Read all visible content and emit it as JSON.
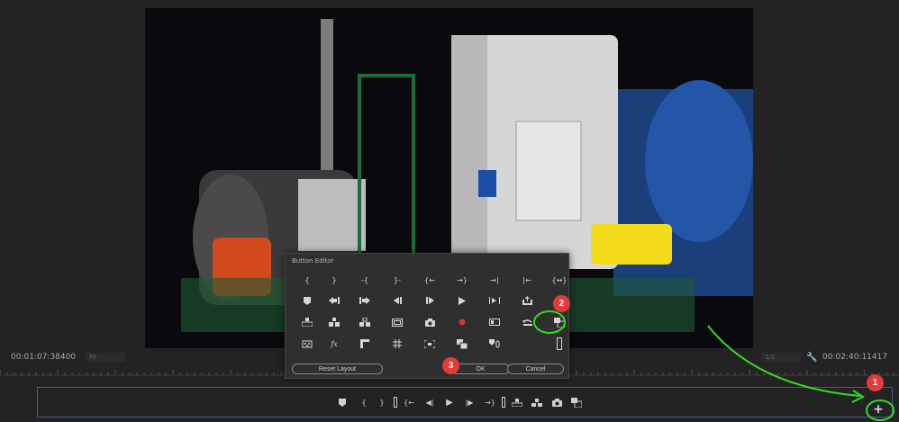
{
  "player": {
    "timecode_in": "00:01:07:38400",
    "timecode_out": "00:02:40:11417",
    "fit_label": "Fit",
    "resolution_label": "1/2"
  },
  "button_editor": {
    "title": "Button Editor",
    "reset_label": "Reset Layout",
    "ok_label": "OK",
    "cancel_label": "Cancel",
    "grid": [
      [
        "{",
        "}",
        "-{",
        "}-",
        "{←",
        "→}",
        "→|",
        "|←",
        "{↔}"
      ],
      [
        "marker-icon",
        "go-to-in-icon",
        "go-to-out-icon",
        "step-back-icon",
        "step-forward-icon",
        "play-icon",
        "play-in-to-out-icon",
        "export-icon",
        "insert-icon"
      ],
      [
        "lift-icon",
        "extract-icon",
        "overwrite-icon",
        "safe-margins-icon",
        "camera-icon",
        "record-icon",
        "multicam-icon",
        "undo-icon",
        "compare-icon"
      ],
      [
        "vr-icon",
        "fx",
        "overlay-icon",
        "grid-icon",
        "frame-icon",
        "proxy-icon",
        "audio-icon",
        "spacer-icon"
      ]
    ]
  },
  "transport": {
    "buttons": [
      "marker",
      "{",
      "}",
      "|",
      "{←",
      "◀|",
      "▶",
      "|▶",
      "→}",
      "|",
      "lift",
      "extract",
      "camera",
      "compare"
    ],
    "add_label": "+"
  },
  "annotations": {
    "badge_1": "1",
    "badge_2": "2",
    "badge_3": "3"
  },
  "colors": {
    "highlight_green": "#33dd22",
    "badge_red": "#e33b3b",
    "bar_border": "#3a5fa0"
  }
}
